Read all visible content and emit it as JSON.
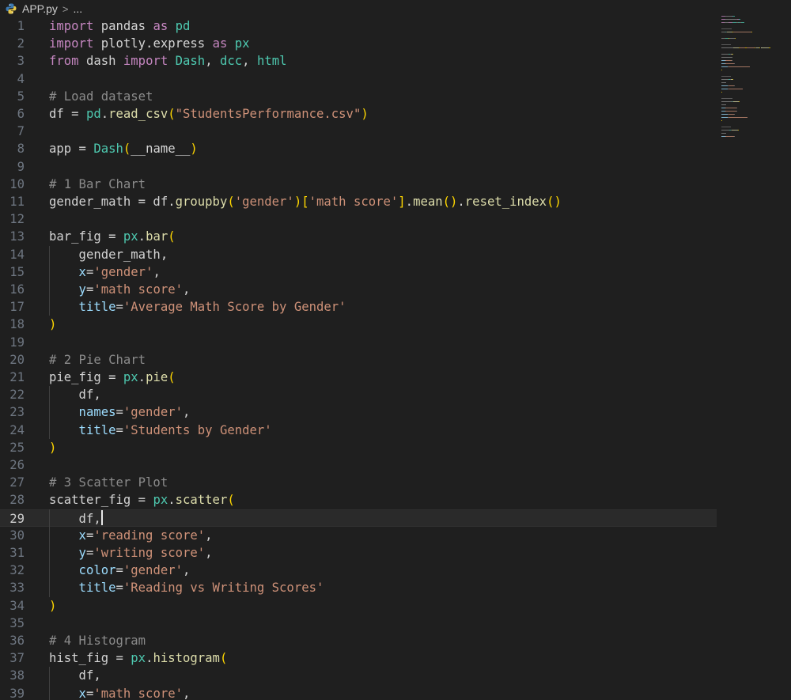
{
  "breadcrumb": {
    "file": "APP.py",
    "separator": ">",
    "more": "..."
  },
  "editor": {
    "current_line": 29,
    "lines": [
      {
        "n": "1",
        "tokens": [
          [
            "kw",
            "import"
          ],
          [
            "id",
            " pandas "
          ],
          [
            "kw",
            "as"
          ],
          [
            "mod",
            " pd"
          ]
        ]
      },
      {
        "n": "2",
        "tokens": [
          [
            "kw",
            "import"
          ],
          [
            "id",
            " plotly.express "
          ],
          [
            "kw",
            "as"
          ],
          [
            "mod",
            " px"
          ]
        ]
      },
      {
        "n": "3",
        "tokens": [
          [
            "kw",
            "from"
          ],
          [
            "id",
            " dash "
          ],
          [
            "kw",
            "import"
          ],
          [
            "mod",
            " Dash"
          ],
          [
            "id",
            ", "
          ],
          [
            "mod",
            "dcc"
          ],
          [
            "id",
            ", "
          ],
          [
            "mod",
            "html"
          ]
        ]
      },
      {
        "n": "4",
        "tokens": []
      },
      {
        "n": "5",
        "tokens": [
          [
            "cmg",
            "# Load dataset"
          ]
        ]
      },
      {
        "n": "6",
        "tokens": [
          [
            "id",
            "df = "
          ],
          [
            "mod",
            "pd"
          ],
          [
            "id",
            "."
          ],
          [
            "fn",
            "read_csv"
          ],
          [
            "p1",
            "("
          ],
          [
            "str",
            "\"StudentsPerformance.csv\""
          ],
          [
            "p1",
            ")"
          ]
        ]
      },
      {
        "n": "7",
        "tokens": []
      },
      {
        "n": "8",
        "tokens": [
          [
            "id",
            "app = "
          ],
          [
            "mod",
            "Dash"
          ],
          [
            "p1",
            "("
          ],
          [
            "id",
            "__name__"
          ],
          [
            "p1",
            ")"
          ]
        ]
      },
      {
        "n": "9",
        "tokens": []
      },
      {
        "n": "10",
        "tokens": [
          [
            "cmg",
            "# 1 Bar Chart"
          ]
        ]
      },
      {
        "n": "11",
        "tokens": [
          [
            "id",
            "gender_math = df."
          ],
          [
            "fn",
            "groupby"
          ],
          [
            "p1",
            "("
          ],
          [
            "str",
            "'gender'"
          ],
          [
            "p1",
            ")"
          ],
          [
            "p1",
            "["
          ],
          [
            "str",
            "'math score'"
          ],
          [
            "p1",
            "]"
          ],
          [
            "id",
            "."
          ],
          [
            "fn",
            "mean"
          ],
          [
            "p1",
            "()"
          ],
          [
            "id",
            "."
          ],
          [
            "fn",
            "reset_index"
          ],
          [
            "p1",
            "()"
          ]
        ]
      },
      {
        "n": "12",
        "tokens": []
      },
      {
        "n": "13",
        "tokens": [
          [
            "id",
            "bar_fig = "
          ],
          [
            "mod",
            "px"
          ],
          [
            "id",
            "."
          ],
          [
            "fn",
            "bar"
          ],
          [
            "p1",
            "("
          ]
        ]
      },
      {
        "n": "14",
        "tokens": [
          [
            "id",
            "    gender_math,"
          ]
        ]
      },
      {
        "n": "15",
        "tokens": [
          [
            "kwa",
            "    x"
          ],
          [
            "op",
            "="
          ],
          [
            "str",
            "'gender'"
          ],
          [
            "id",
            ","
          ]
        ]
      },
      {
        "n": "16",
        "tokens": [
          [
            "kwa",
            "    y"
          ],
          [
            "op",
            "="
          ],
          [
            "str",
            "'math score'"
          ],
          [
            "id",
            ","
          ]
        ]
      },
      {
        "n": "17",
        "tokens": [
          [
            "kwa",
            "    title"
          ],
          [
            "op",
            "="
          ],
          [
            "str",
            "'Average Math Score by Gender'"
          ]
        ]
      },
      {
        "n": "18",
        "tokens": [
          [
            "p1",
            ")"
          ]
        ]
      },
      {
        "n": "19",
        "tokens": []
      },
      {
        "n": "20",
        "tokens": [
          [
            "cmg",
            "# 2 Pie Chart"
          ]
        ]
      },
      {
        "n": "21",
        "tokens": [
          [
            "id",
            "pie_fig = "
          ],
          [
            "mod",
            "px"
          ],
          [
            "id",
            "."
          ],
          [
            "fn",
            "pie"
          ],
          [
            "p1",
            "("
          ]
        ]
      },
      {
        "n": "22",
        "tokens": [
          [
            "id",
            "    df,"
          ]
        ]
      },
      {
        "n": "23",
        "tokens": [
          [
            "kwa",
            "    names"
          ],
          [
            "op",
            "="
          ],
          [
            "str",
            "'gender'"
          ],
          [
            "id",
            ","
          ]
        ]
      },
      {
        "n": "24",
        "tokens": [
          [
            "kwa",
            "    title"
          ],
          [
            "op",
            "="
          ],
          [
            "str",
            "'Students by Gender'"
          ]
        ]
      },
      {
        "n": "25",
        "tokens": [
          [
            "p1",
            ")"
          ]
        ]
      },
      {
        "n": "26",
        "tokens": []
      },
      {
        "n": "27",
        "tokens": [
          [
            "cmg",
            "# 3 Scatter Plot"
          ]
        ]
      },
      {
        "n": "28",
        "tokens": [
          [
            "id",
            "scatter_fig = "
          ],
          [
            "mod",
            "px"
          ],
          [
            "id",
            "."
          ],
          [
            "fn",
            "scatter"
          ],
          [
            "p1",
            "("
          ]
        ]
      },
      {
        "n": "29",
        "tokens": [
          [
            "id",
            "    df,"
          ]
        ],
        "cursor": true
      },
      {
        "n": "30",
        "tokens": [
          [
            "kwa",
            "    x"
          ],
          [
            "op",
            "="
          ],
          [
            "str",
            "'reading score'"
          ],
          [
            "id",
            ","
          ]
        ]
      },
      {
        "n": "31",
        "tokens": [
          [
            "kwa",
            "    y"
          ],
          [
            "op",
            "="
          ],
          [
            "str",
            "'writing score'"
          ],
          [
            "id",
            ","
          ]
        ]
      },
      {
        "n": "32",
        "tokens": [
          [
            "kwa",
            "    color"
          ],
          [
            "op",
            "="
          ],
          [
            "str",
            "'gender'"
          ],
          [
            "id",
            ","
          ]
        ]
      },
      {
        "n": "33",
        "tokens": [
          [
            "kwa",
            "    title"
          ],
          [
            "op",
            "="
          ],
          [
            "str",
            "'Reading vs Writing Scores'"
          ]
        ]
      },
      {
        "n": "34",
        "tokens": [
          [
            "p1",
            ")"
          ]
        ]
      },
      {
        "n": "35",
        "tokens": []
      },
      {
        "n": "36",
        "tokens": [
          [
            "cmg",
            "# 4 Histogram"
          ]
        ]
      },
      {
        "n": "37",
        "tokens": [
          [
            "id",
            "hist_fig = "
          ],
          [
            "mod",
            "px"
          ],
          [
            "id",
            "."
          ],
          [
            "fn",
            "histogram"
          ],
          [
            "p1",
            "("
          ]
        ]
      },
      {
        "n": "38",
        "tokens": [
          [
            "id",
            "    df,"
          ]
        ]
      },
      {
        "n": "39",
        "tokens": [
          [
            "kwa",
            "    x"
          ],
          [
            "op",
            "="
          ],
          [
            "str",
            "'math score'"
          ],
          [
            "id",
            ","
          ]
        ]
      }
    ]
  },
  "colors": {
    "background": "#1f1f1f",
    "keyword": "#c586c0",
    "string": "#ce9178",
    "function": "#dcdcaa",
    "module": "#4ec9b0",
    "variable": "#9cdcfe",
    "comment": "#8b8b8b",
    "bracket": "#ffd700"
  },
  "icons": {
    "file_icon": "python-file-icon"
  }
}
